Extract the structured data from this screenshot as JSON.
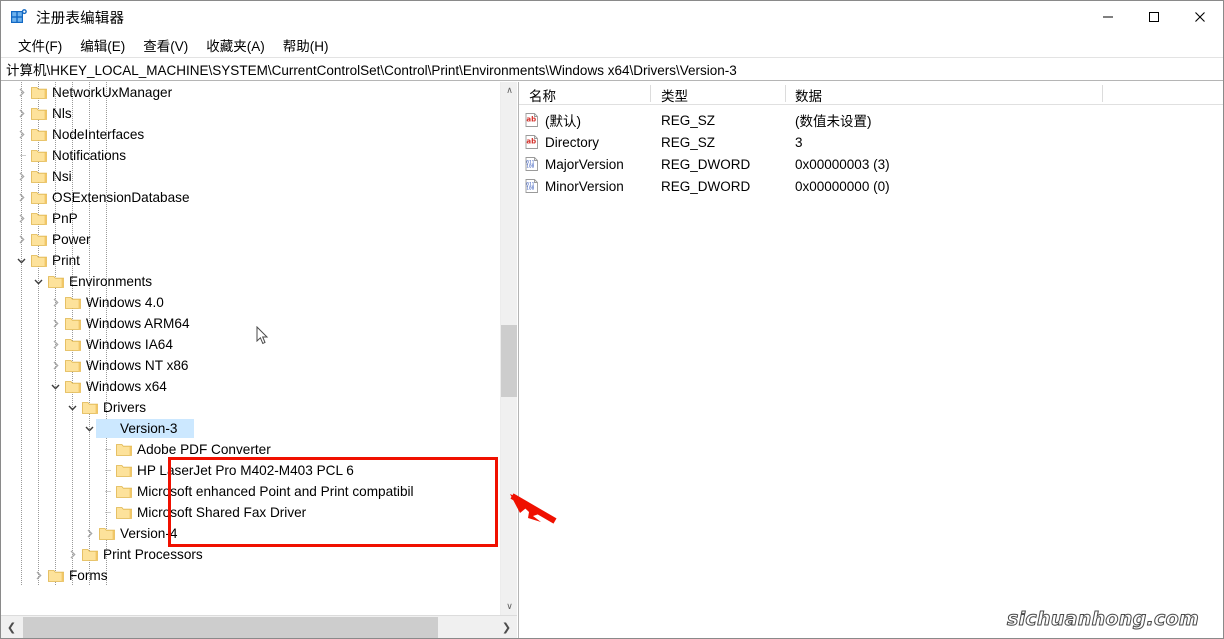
{
  "window": {
    "title": "注册表编辑器",
    "icon": "registry-editor-icon",
    "controls": {
      "minimize": "—",
      "maximize": "□",
      "close": "✕"
    }
  },
  "menubar": {
    "items": [
      {
        "label": "文件(F)",
        "name": "menu-file"
      },
      {
        "label": "编辑(E)",
        "name": "menu-edit"
      },
      {
        "label": "查看(V)",
        "name": "menu-view"
      },
      {
        "label": "收藏夹(A)",
        "name": "menu-favorites"
      },
      {
        "label": "帮助(H)",
        "name": "menu-help"
      }
    ]
  },
  "address": {
    "path": "计算机\\HKEY_LOCAL_MACHINE\\SYSTEM\\CurrentControlSet\\Control\\Print\\Environments\\Windows x64\\Drivers\\Version-3"
  },
  "tree": {
    "nodes": [
      {
        "label": "NetworkUxManager",
        "indent": 1,
        "state": "collapsed",
        "selected": false,
        "boxed": false
      },
      {
        "label": "Nls",
        "indent": 1,
        "state": "collapsed",
        "selected": false,
        "boxed": false
      },
      {
        "label": "NodeInterfaces",
        "indent": 1,
        "state": "collapsed",
        "selected": false,
        "boxed": false
      },
      {
        "label": "Notifications",
        "indent": 1,
        "state": "leaf",
        "selected": false,
        "boxed": false
      },
      {
        "label": "Nsi",
        "indent": 1,
        "state": "collapsed",
        "selected": false,
        "boxed": false
      },
      {
        "label": "OSExtensionDatabase",
        "indent": 1,
        "state": "collapsed",
        "selected": false,
        "boxed": false
      },
      {
        "label": "PnP",
        "indent": 1,
        "state": "collapsed",
        "selected": false,
        "boxed": false
      },
      {
        "label": "Power",
        "indent": 1,
        "state": "collapsed",
        "selected": false,
        "boxed": false
      },
      {
        "label": "Print",
        "indent": 1,
        "state": "expanded",
        "selected": false,
        "boxed": false
      },
      {
        "label": "Environments",
        "indent": 2,
        "state": "expanded",
        "selected": false,
        "boxed": false
      },
      {
        "label": "Windows 4.0",
        "indent": 3,
        "state": "collapsed",
        "selected": false,
        "boxed": false
      },
      {
        "label": "Windows ARM64",
        "indent": 3,
        "state": "collapsed",
        "selected": false,
        "boxed": false
      },
      {
        "label": "Windows IA64",
        "indent": 3,
        "state": "collapsed",
        "selected": false,
        "boxed": false
      },
      {
        "label": "Windows NT x86",
        "indent": 3,
        "state": "collapsed",
        "selected": false,
        "boxed": false
      },
      {
        "label": "Windows x64",
        "indent": 3,
        "state": "expanded",
        "selected": false,
        "boxed": false
      },
      {
        "label": "Drivers",
        "indent": 4,
        "state": "expanded",
        "selected": false,
        "boxed": false
      },
      {
        "label": "Version-3",
        "indent": 5,
        "state": "expanded",
        "selected": true,
        "boxed": false
      },
      {
        "label": "Adobe PDF Converter",
        "indent": 6,
        "state": "leaf",
        "selected": false,
        "boxed": true
      },
      {
        "label": "HP LaserJet Pro M402-M403 PCL 6",
        "indent": 6,
        "state": "leaf",
        "selected": false,
        "boxed": true
      },
      {
        "label": "Microsoft enhanced Point and Print compatibil",
        "indent": 6,
        "state": "leaf",
        "selected": false,
        "boxed": true
      },
      {
        "label": "Microsoft Shared Fax Driver",
        "indent": 6,
        "state": "leaf",
        "selected": false,
        "boxed": true
      },
      {
        "label": "Version-4",
        "indent": 5,
        "state": "collapsed",
        "selected": false,
        "boxed": false
      },
      {
        "label": "Print Processors",
        "indent": 4,
        "state": "collapsed",
        "selected": false,
        "boxed": false
      },
      {
        "label": "Forms",
        "indent": 2,
        "state": "collapsed",
        "selected": false,
        "boxed": false
      }
    ]
  },
  "values": {
    "columns": [
      {
        "label": "名称",
        "name": "column-name"
      },
      {
        "label": "类型",
        "name": "column-type"
      },
      {
        "label": "数据",
        "name": "column-data"
      }
    ],
    "rows": [
      {
        "name": "(默认)",
        "type": "REG_SZ",
        "data": "(数值未设置)",
        "icon": "string-value-icon"
      },
      {
        "name": "Directory",
        "type": "REG_SZ",
        "data": "3",
        "icon": "string-value-icon"
      },
      {
        "name": "MajorVersion",
        "type": "REG_DWORD",
        "data": "0x00000003 (3)",
        "icon": "dword-value-icon"
      },
      {
        "name": "MinorVersion",
        "type": "REG_DWORD",
        "data": "0x00000000 (0)",
        "icon": "dword-value-icon"
      }
    ]
  },
  "annotations": {
    "highlight_color": "#f01000",
    "arrow": "red-arrow-pointing-left",
    "watermark": "sichuanhong.com"
  },
  "scrollbars": {
    "vertical_up": "∧",
    "vertical_down": "∨",
    "horizontal_left": "❮",
    "horizontal_right": "❯"
  }
}
